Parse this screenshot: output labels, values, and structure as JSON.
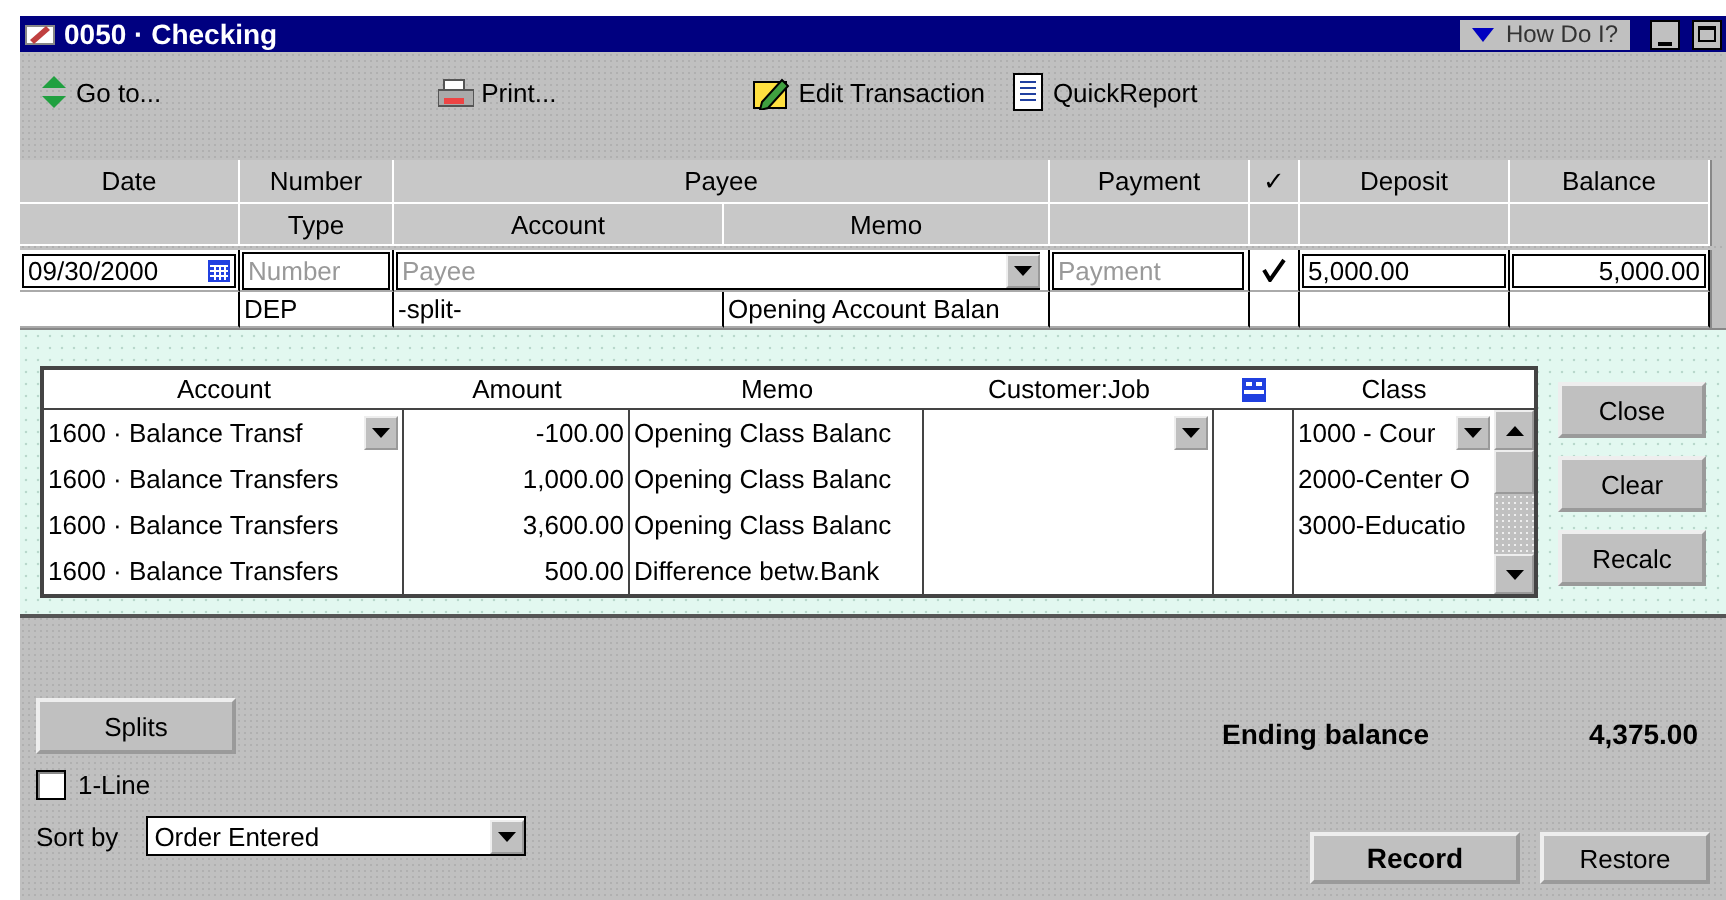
{
  "window": {
    "title": "0050 · Checking",
    "help_menu": "How Do I?"
  },
  "toolbar": [
    {
      "label": "Go to..."
    },
    {
      "label": "Print..."
    },
    {
      "label": "Edit Transaction"
    },
    {
      "label": "QuickReport"
    }
  ],
  "register": {
    "header_row1": [
      "Date",
      "Number",
      "Payee",
      "Payment",
      "✓",
      "Deposit",
      "Balance"
    ],
    "header_row2": [
      "Type",
      "Account",
      "Memo"
    ],
    "entry": {
      "date": "09/30/2000",
      "number_placeholder": "Number",
      "payee_placeholder": "Payee",
      "payment_placeholder": "Payment",
      "cleared": true,
      "deposit": "5,000.00",
      "balance": "5,000.00",
      "type": "DEP",
      "account": "-split-",
      "memo": "Opening Account Balan"
    }
  },
  "splits": {
    "columns": [
      "Account",
      "Amount",
      "Memo",
      "Customer:Job",
      "Class"
    ],
    "rows": [
      {
        "account": "1600 · Balance Transf",
        "amount": "-100.00",
        "memo": "Opening Class Balanc",
        "class": "1000 - Cour"
      },
      {
        "account": "1600 · Balance Transfers",
        "amount": "1,000.00",
        "memo": "Opening Class Balanc",
        "class": "2000-Center O"
      },
      {
        "account": "1600 · Balance Transfers",
        "amount": "3,600.00",
        "memo": "Opening Class Balanc",
        "class": "3000-Educatio"
      },
      {
        "account": "1600 · Balance Transfers",
        "amount": "500.00",
        "memo": "Difference betw.Bank"
      }
    ],
    "buttons": [
      "Close",
      "Clear",
      "Recalc"
    ]
  },
  "footer": {
    "splits_button": "Splits",
    "one_line": {
      "label": "1-Line",
      "checked": false
    },
    "sort_label": "Sort by",
    "sort_value": "Order Entered",
    "ending_balance_label": "Ending balance",
    "ending_balance": "4,375.00",
    "buttons": [
      "Record",
      "Restore"
    ]
  }
}
